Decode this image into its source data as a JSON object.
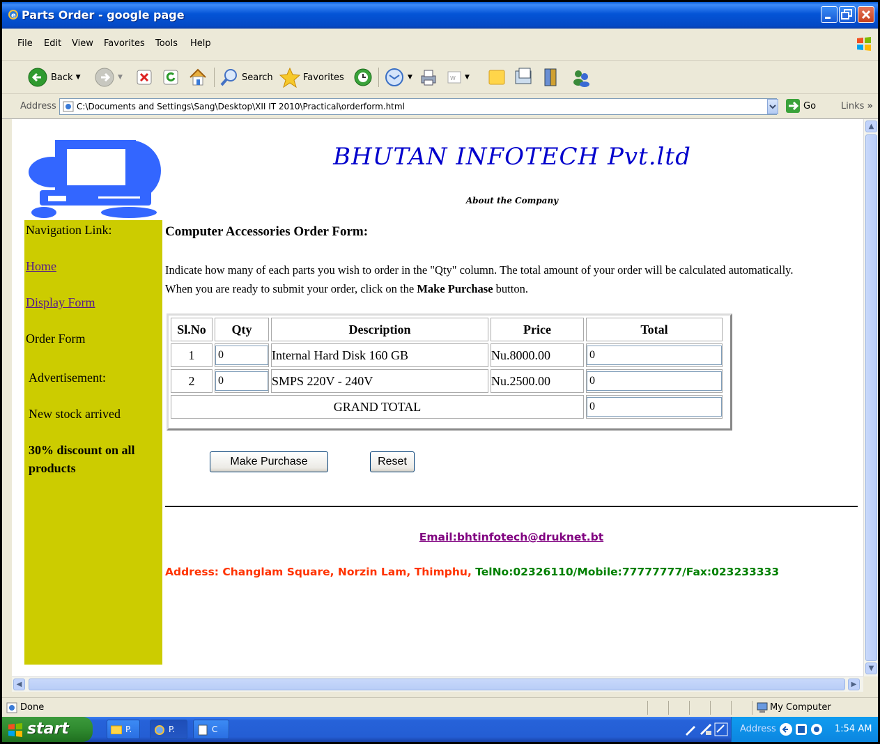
{
  "window": {
    "title": "Parts Order - google page"
  },
  "menu": [
    "File",
    "Edit",
    "View",
    "Favorites",
    "Tools",
    "Help"
  ],
  "toolbar": {
    "back_label": "Back",
    "search_label": "Search",
    "favorites_label": "Favorites"
  },
  "address": {
    "label": "Address",
    "url": "C:\\Documents and Settings\\Sang\\Desktop\\XII IT 2010\\Practical\\orderform.html",
    "go_label": "Go",
    "links_label": "Links"
  },
  "page": {
    "banner": "BHUTAN INFOTECH Pvt.ltd",
    "about_link": "About the Company",
    "sidebar": {
      "heading": "Navigation Link:",
      "home": "Home",
      "display_form": "Display Form",
      "order_form": "Order Form",
      "advertisement": "Advertisement:",
      "ad_line1": "New stock arrived",
      "ad_line2a": "30% discount on all",
      "ad_line2b": "products"
    },
    "form_title": "Computer Accessories Order Form:",
    "instructions_line1": "Indicate how many of each parts you wish to order in the \"Qty\" column. The total amount of your order will be calculated automatically.",
    "instructions_line2_pre": "When you are ready to submit your order, click on the ",
    "instructions_line2_bold": "Make Purchase",
    "instructions_line2_post": " button.",
    "table": {
      "headers": [
        "Sl.No",
        "Qty",
        "Description",
        "Price",
        "Total"
      ],
      "rows": [
        {
          "slno": "1",
          "qty": "0",
          "description": "Internal Hard Disk 160 GB",
          "price": "Nu.8000.00",
          "total": "0"
        },
        {
          "slno": "2",
          "qty": "0",
          "description": "SMPS 220V - 240V",
          "price": "Nu.2500.00",
          "total": "0"
        }
      ],
      "grand_total_label": "GRAND TOTAL",
      "grand_total_value": "0"
    },
    "buttons": {
      "purchase": "Make Purchase",
      "reset": "Reset"
    },
    "email": "Email:bhtinfotech@druknet.bt",
    "address_red": "Address: Changlam Square, Norzin Lam, Thimphu, ",
    "address_green": "TelNo:02326110/Mobile:77777777/Fax:023233333"
  },
  "status": {
    "text": "Done",
    "zone": "My Computer"
  },
  "taskbar": {
    "start": "start",
    "tasks": [
      "P.",
      "P.",
      "C"
    ],
    "tray_address": "Address",
    "clock": "1:54 AM"
  }
}
